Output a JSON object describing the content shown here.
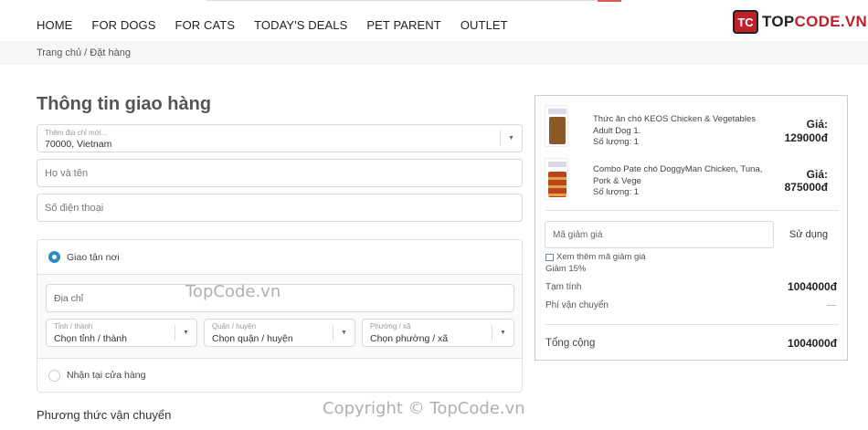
{
  "nav": {
    "items": [
      "HOME",
      "FOR DOGS",
      "FOR CATS",
      "TODAY'S DEALS",
      "PET PARENT",
      "OUTLET"
    ]
  },
  "logo": {
    "mark": "TC",
    "text_prefix": "TOP",
    "text_suffix": "CODE.VN"
  },
  "breadcrumb": "Trang chủ / Đặt hàng",
  "shipping_info": {
    "title": "Thông tin giao hàng",
    "address_select": {
      "label": "Thêm địa chỉ mới...",
      "value": "70000, Vietnam"
    },
    "fullname_placeholder": "Họ và tên",
    "phone_placeholder": "Số điện thoại",
    "delivery_home_label": "Giao tận nơi",
    "address_placeholder": "Địa chỉ",
    "province": {
      "label": "Tỉnh / thành",
      "value": "Chọn tỉnh / thành"
    },
    "district": {
      "label": "Quận / huyện",
      "value": "Chọn quận / huyện"
    },
    "ward": {
      "label": "Phường / xã",
      "value": "Chọn phường / xã"
    },
    "pickup_label": "Nhận tại cửa hàng",
    "shipping_method_title": "Phương thức vận chuyển"
  },
  "cart": {
    "items": [
      {
        "name": "Thức ăn chó KEOS Chicken & Vegetables Adult Dog 1.",
        "qty": "Số lượng: 1",
        "price_label": "Giá:",
        "price": "129000đ"
      },
      {
        "name": "Combo Pate chó DoggyMan Chicken, Tuna, Pork & Vege",
        "qty": "Số lượng: 1",
        "price_label": "Giá:",
        "price": "875000đ"
      }
    ],
    "coupon_placeholder": "Mã giảm giá",
    "coupon_button": "Sử dụng",
    "more_coupons": "Xem thêm mã giảm giá",
    "discount_tag": "Giảm 15%",
    "subtotal_label": "Tạm tính",
    "subtotal": "1004000đ",
    "shipping_fee_label": "Phí vận chuyển",
    "shipping_fee": "—",
    "total_label": "Tổng cộng",
    "total": "1004000đ"
  },
  "watermarks": {
    "center": "TopCode.vn",
    "bottom": "Copyright © TopCode.vn"
  },
  "colors": {
    "accent": "#2a8fbd",
    "brand_red": "#c0202a"
  }
}
